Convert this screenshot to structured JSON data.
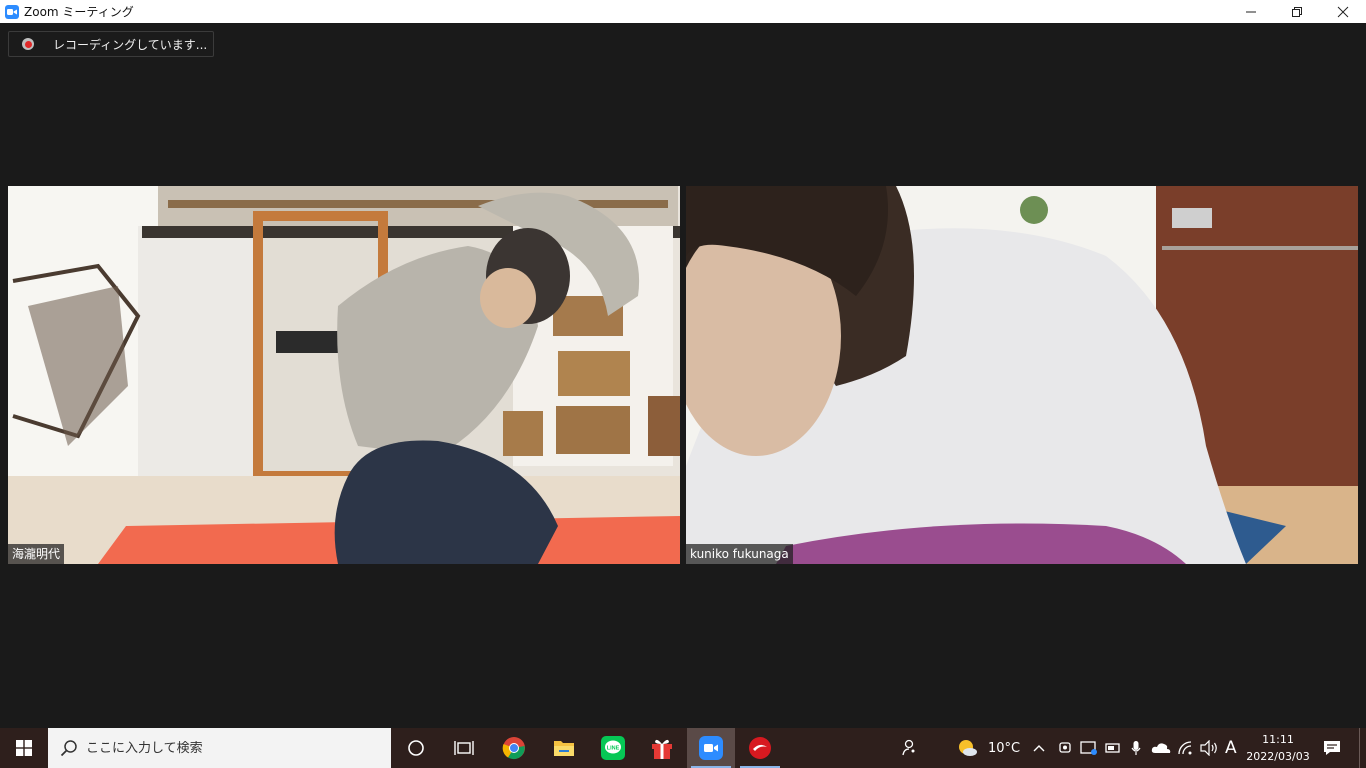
{
  "window": {
    "title": "Zoom ミーティング"
  },
  "recording": {
    "status_text": "レコーディングしています..."
  },
  "participants": [
    {
      "name": "海瀧明代"
    },
    {
      "name": "kuniko fukunaga"
    }
  ],
  "taskbar": {
    "search_placeholder": "ここに入力して検索",
    "pinned_apps": [
      "cortana-icon",
      "task-view-icon",
      "chrome-icon",
      "file-explorer-icon",
      "line-icon",
      "gift-icon",
      "zoom-icon",
      "trend-micro-icon"
    ],
    "weather_temp": "10°C",
    "ime_indicator": "A",
    "clock_time": "11:11",
    "clock_date": "2022/03/03"
  },
  "colors": {
    "zoom_blue": "#2d8cff",
    "recording_red": "#e02828",
    "taskbar_bg": "#2e1f1c"
  }
}
